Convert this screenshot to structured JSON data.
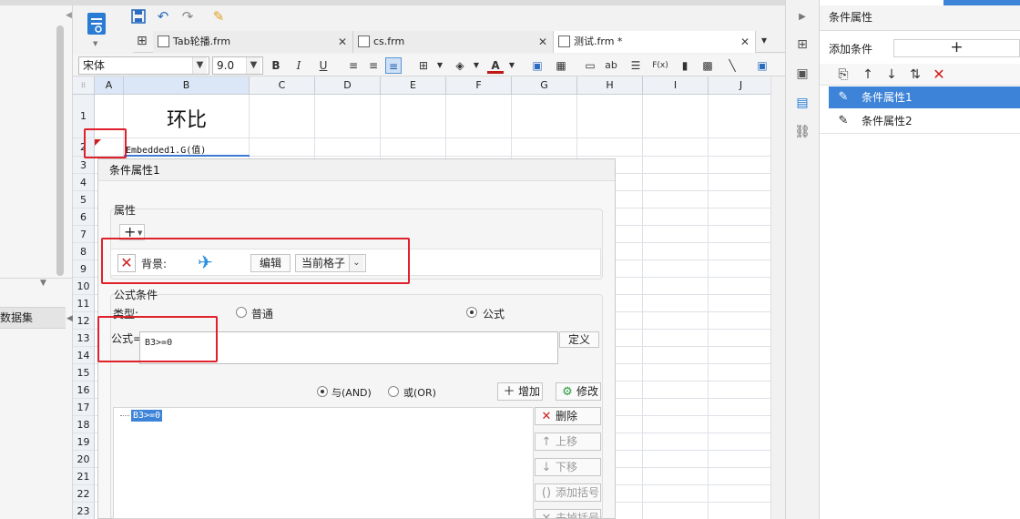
{
  "left_panel": {
    "dataset_tab": "数据集"
  },
  "toolbar": {
    "tabs": [
      {
        "label": "Tab轮播.frm"
      },
      {
        "label": "cs.frm"
      },
      {
        "label": "测试.frm *"
      }
    ],
    "font_family": "宋体",
    "font_size": "9.0",
    "bold": "B",
    "italic": "I",
    "underline": "U",
    "color_a": "A",
    "ab_label": "ab",
    "fx_label": "F(x)"
  },
  "sheet": {
    "columns": [
      "A",
      "B",
      "C",
      "D",
      "E",
      "F",
      "G",
      "H",
      "I",
      "J"
    ],
    "rows": [
      "1",
      "2",
      "3",
      "4",
      "5",
      "6",
      "7",
      "8",
      "9",
      "10",
      "11",
      "12",
      "13",
      "14",
      "15",
      "16",
      "17",
      "18",
      "19",
      "20",
      "21",
      "22",
      "23"
    ],
    "cell_b1": "环比",
    "cell_b2": "Embedded1.G(值)"
  },
  "dialog": {
    "title": "条件属性1",
    "attribute_group": "属性",
    "plus": "+",
    "background_label": "背景:",
    "edit_button": "编辑",
    "scope_value": "当前格子",
    "formula_group": "公式条件",
    "type_label": "类型:",
    "type_normal": "普通",
    "type_formula": "公式",
    "formula_label": "公式=",
    "formula_value": "B3>=0",
    "define_button": "定义",
    "and_label": "与(AND)",
    "or_label": "或(OR)",
    "add_button": "增加",
    "modify_button": "修改",
    "condition_item": "B3>=0",
    "delete_button": "删除",
    "move_up_button": "上移",
    "move_down_button": "下移",
    "add_bracket_button": "添加括号",
    "remove_bracket_button": "去掉括号"
  },
  "right_panel": {
    "title": "条件属性",
    "add_condition_label": "添加条件",
    "add_condition_button": "+",
    "conditions": [
      {
        "label": "条件属性1",
        "selected": true
      },
      {
        "label": "条件属性2",
        "selected": false
      }
    ]
  },
  "colors": {
    "accent": "#3d84d8",
    "highlight_red": "#e0202a",
    "plane_blue": "#2a8fe0"
  }
}
